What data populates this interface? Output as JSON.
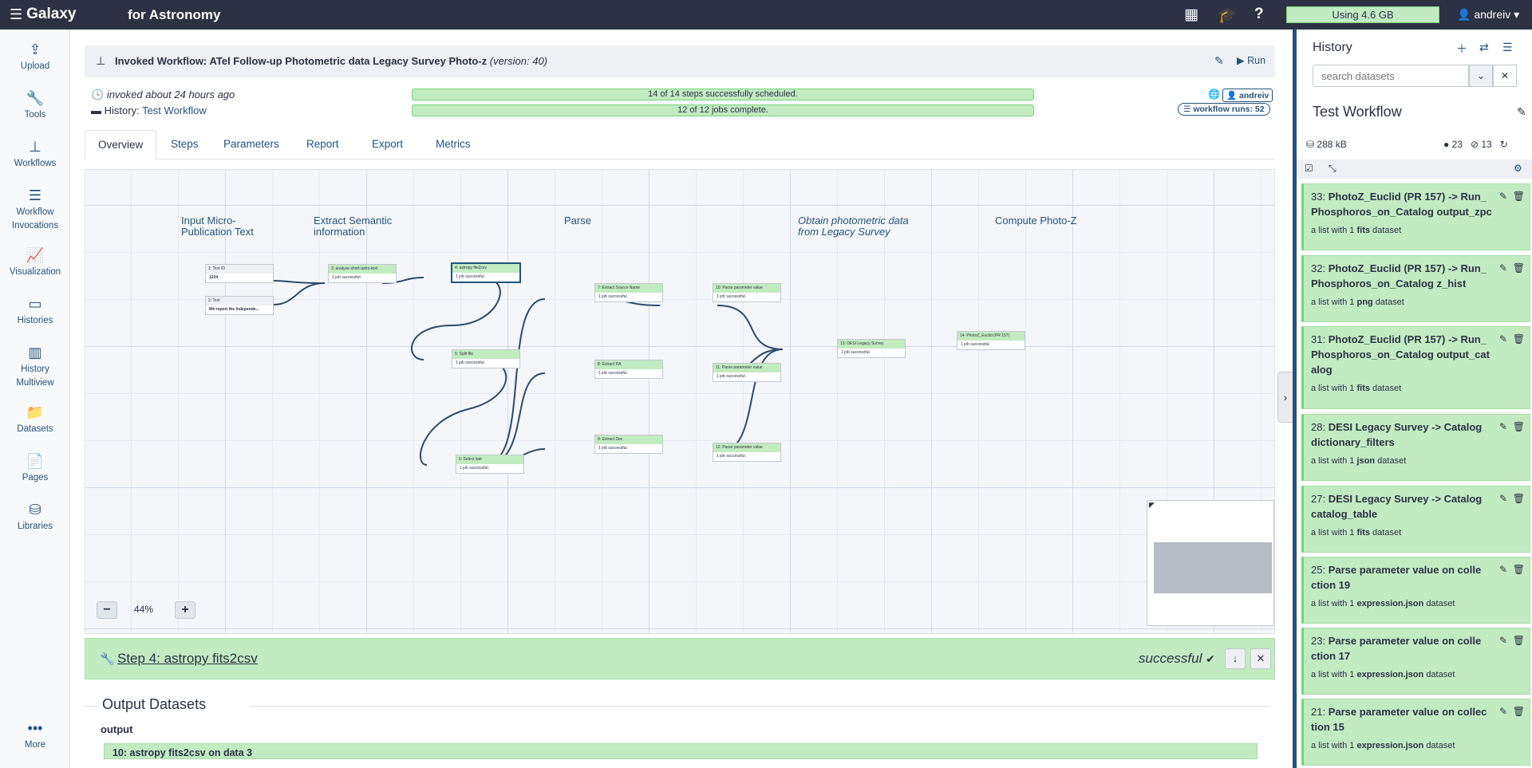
{
  "topbar": {
    "brand": "Galaxy",
    "subtitle": "for Astronomy",
    "quota": "Using 4.6 GB",
    "user": "andreiv"
  },
  "activity": [
    {
      "label": "Upload",
      "icon": "upload-icon"
    },
    {
      "label": "Tools",
      "icon": "wrench-icon"
    },
    {
      "label": "Workflows",
      "icon": "sitemap-icon"
    },
    {
      "label": "Workflow Invocations",
      "icon": "list-icon"
    },
    {
      "label": "Visualization",
      "icon": "chart-icon"
    },
    {
      "label": "Histories",
      "icon": "hdd-icon"
    },
    {
      "label": "History Multiview",
      "icon": "columns-icon"
    },
    {
      "label": "Datasets",
      "icon": "folder-icon"
    },
    {
      "label": "Pages",
      "icon": "file-icon"
    },
    {
      "label": "Libraries",
      "icon": "database-icon"
    },
    {
      "label": "More",
      "icon": "ellipsis-icon"
    }
  ],
  "invocation": {
    "title": "Invoked Workflow: ATel Follow-up Photometric data Legacy Survey Photo-z",
    "version": "(version: 40)",
    "run_label": "Run",
    "invoked": "invoked about 24 hours ago",
    "history_label": "History:",
    "history_name": "Test Workflow",
    "scheduled": "14 of 14 steps successfully scheduled.",
    "jobs": "12 of 12 jobs complete.",
    "owner": "andreiv",
    "runs": "workflow runs: 52"
  },
  "tabs": [
    "Overview",
    "Steps",
    "Parameters",
    "Report",
    "Export",
    "Metrics"
  ],
  "canvas": {
    "zoom": "44%",
    "frames": [
      {
        "id": "f1",
        "text": "Input Micro-Publication Text",
        "italic": false
      },
      {
        "id": "f2",
        "text": "Extract Semantic information",
        "italic": false
      },
      {
        "id": "f3",
        "text": "Parse",
        "italic": false
      },
      {
        "id": "f4",
        "text": "Obtain photometric data from Legacy Survey",
        "italic": true
      },
      {
        "id": "f5",
        "text": "Compute Photo-Z",
        "italic": false
      }
    ],
    "nodes": [
      {
        "id": "n1",
        "title": "1: Text ID",
        "body": "1234",
        "input": true
      },
      {
        "id": "n2",
        "title": "2: Text",
        "body": "We report the Independe...",
        "input": true
      },
      {
        "id": "n3",
        "title": "3: analyse-short-astro-text",
        "body": "1 job successful.",
        "input": false
      },
      {
        "id": "n4",
        "title": "4: astropy fits2csv",
        "body": "1 job successful.",
        "input": false
      },
      {
        "id": "n5",
        "title": "5: Split file",
        "body": "1 job successful.",
        "input": false
      },
      {
        "id": "n6",
        "title": "6: Select last",
        "body": "1 job successful.",
        "input": false
      },
      {
        "id": "n7",
        "title": "7: Extract Source Name",
        "body": "1 job successful.",
        "input": false
      },
      {
        "id": "n8",
        "title": "8: Extract RA",
        "body": "1 job successful.",
        "input": false
      },
      {
        "id": "n9",
        "title": "9: Extract Dec",
        "body": "1 job successful.",
        "input": false
      },
      {
        "id": "n10",
        "title": "10: Parse parameter value",
        "body": "1 job successful.",
        "input": false
      },
      {
        "id": "n11",
        "title": "11: Parse parameter value",
        "body": "1 job successful.",
        "input": false
      },
      {
        "id": "n12",
        "title": "12: Parse parameter value",
        "body": "1 job successful.",
        "input": false
      },
      {
        "id": "n13",
        "title": "13: DESI Legacy Survey",
        "body": "1 job successful.",
        "input": false
      },
      {
        "id": "n14",
        "title": "14: PhotoZ_Euclid (PR 157)",
        "body": "1 job successful.",
        "input": false
      }
    ]
  },
  "step": {
    "title": "Step 4: astropy fits2csv",
    "status": "successful",
    "output_heading": "Output Datasets",
    "output_label": "output",
    "output_item": "10: astropy fits2csv on data 3"
  },
  "history": {
    "title": "History",
    "search_placeholder": "search datasets",
    "name": "Test Workflow",
    "size": "288 kB",
    "shown": "23",
    "hidden": "13",
    "items": [
      {
        "num": "33:",
        "name": "PhotoZ_Euclid (PR 157) -> Run_ Phosphoros_on_Catalog output_zpc",
        "pre": "a list with 1",
        "ext": "fits",
        "post": "dataset"
      },
      {
        "num": "32:",
        "name": "PhotoZ_Euclid (PR 157) -> Run_ Phosphoros_on_Catalog z_hist",
        "pre": "a list with 1",
        "ext": "png",
        "post": "dataset"
      },
      {
        "num": "31:",
        "name": "PhotoZ_Euclid (PR 157) -> Run_ Phosphoros_on_Catalog output_cat alog",
        "pre": "a list with 1",
        "ext": "fits",
        "post": "dataset"
      },
      {
        "num": "28:",
        "name": "DESI Legacy Survey -> Catalog dictionary_filters",
        "pre": "a list with 1",
        "ext": "json",
        "post": "dataset"
      },
      {
        "num": "27:",
        "name": "DESI Legacy Survey -> Catalog catalog_table",
        "pre": "a list with 1",
        "ext": "fits",
        "post": "dataset"
      },
      {
        "num": "25:",
        "name": "Parse parameter value on colle ction 19",
        "pre": "a list with 1",
        "ext": "expression.json",
        "post": "dataset"
      },
      {
        "num": "23:",
        "name": "Parse parameter value on colle ction 17",
        "pre": "a list with 1",
        "ext": "expression.json",
        "post": "dataset"
      },
      {
        "num": "21:",
        "name": "Parse parameter value on collec tion 15",
        "pre": "a list with 1",
        "ext": "expression.json",
        "post": "dataset"
      }
    ]
  }
}
